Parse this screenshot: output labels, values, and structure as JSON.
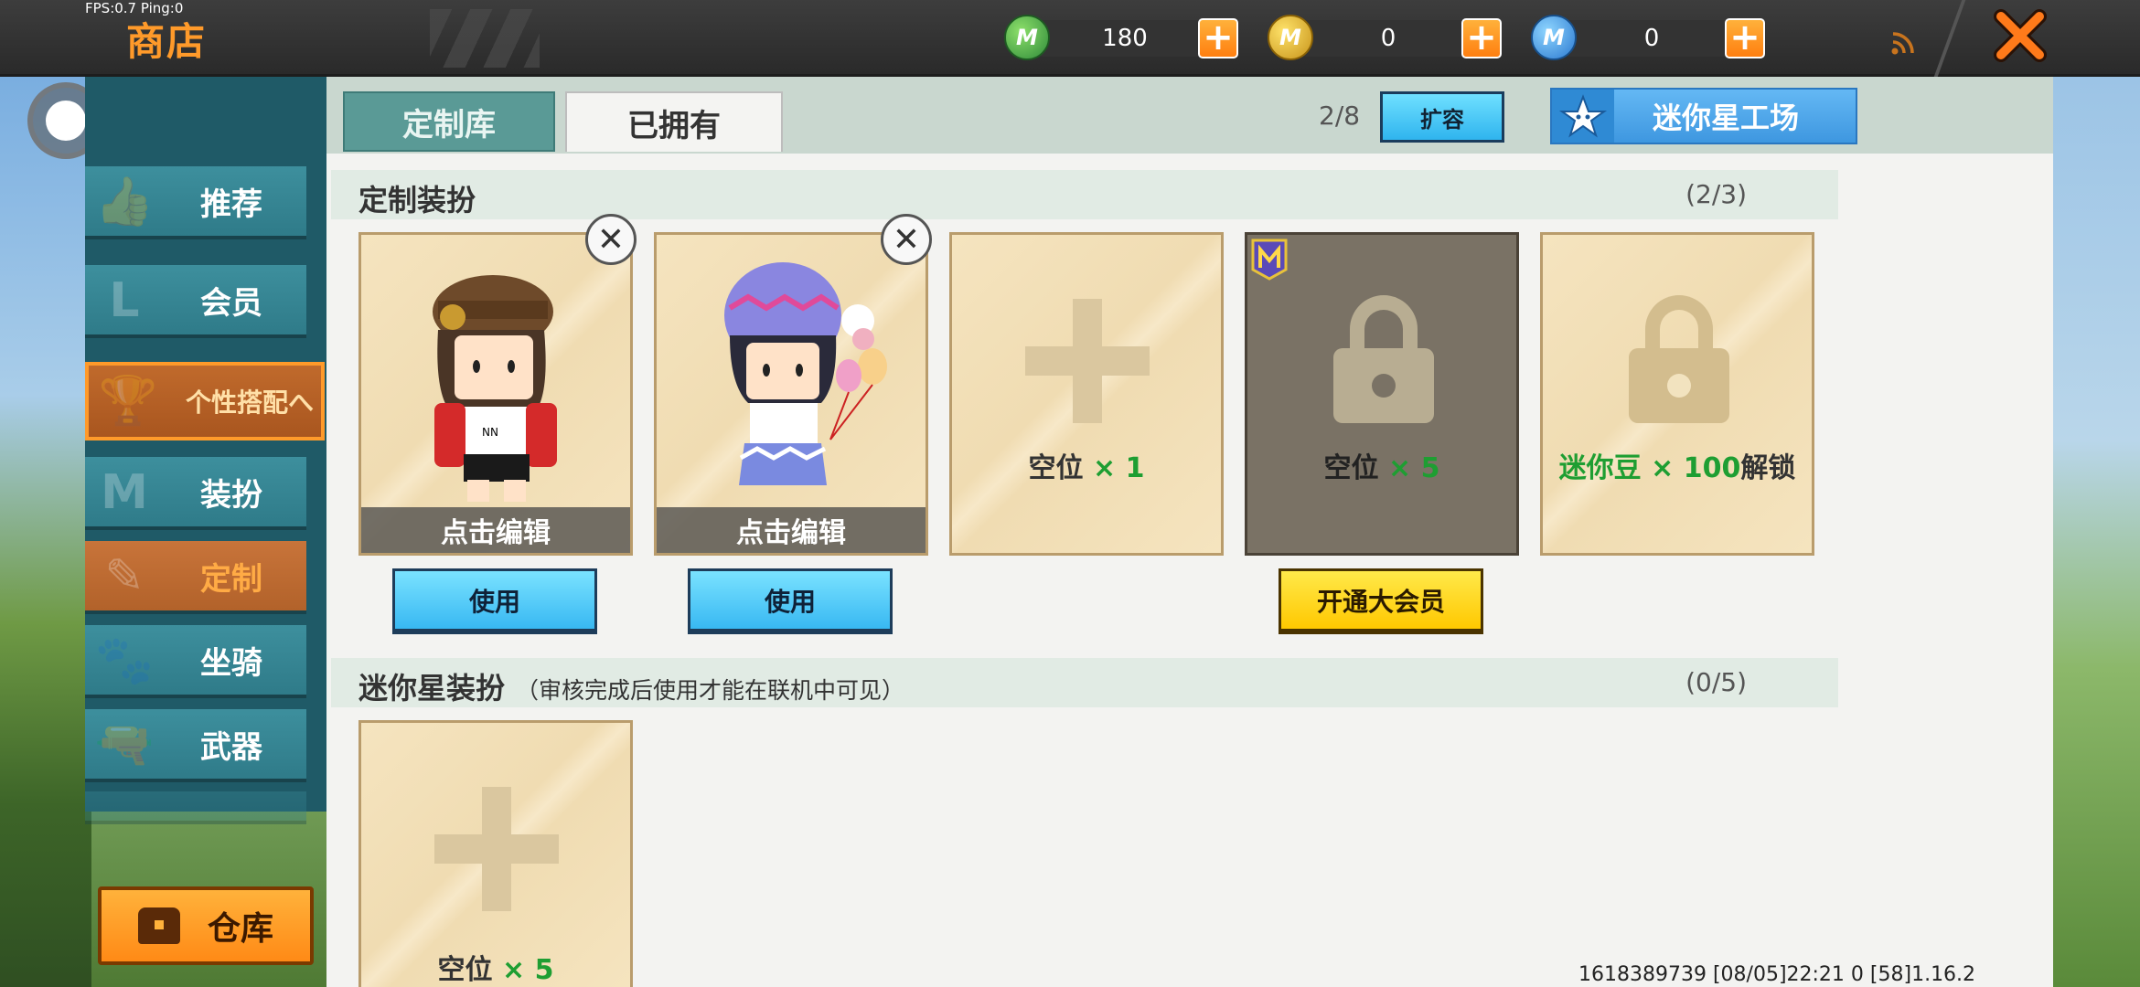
{
  "status": {
    "fps": "FPS:0.7  Ping:0"
  },
  "header": {
    "title": "商店"
  },
  "currencies": [
    {
      "name": "mini-bean",
      "value": "180",
      "color": "#3fa64a",
      "letter": "M"
    },
    {
      "name": "mini-coin",
      "value": "0",
      "color": "#e4b21c",
      "letter": "M"
    },
    {
      "name": "star-coin",
      "value": "0",
      "color": "#3d8ee0",
      "letter": "M"
    }
  ],
  "sidebar": {
    "items": [
      {
        "label": "推荐",
        "icon": "thumbs-up-icon"
      },
      {
        "label": "会员",
        "icon": "vip-icon"
      },
      {
        "label": "个性搭配へ",
        "icon": "trophy-icon"
      },
      {
        "label": "装扮",
        "icon": "shirt-icon"
      },
      {
        "label": "定制",
        "icon": "pencil-icon"
      },
      {
        "label": "坐骑",
        "icon": "mount-icon"
      },
      {
        "label": "武器",
        "icon": "gun-icon"
      }
    ],
    "warehouse_label": "仓库"
  },
  "tabs": {
    "custom": "定制库",
    "owned": "已拥有"
  },
  "capacity": "2/8",
  "expand_label": "扩容",
  "factory_label": "迷你星工场",
  "section1": {
    "title": "定制装扮",
    "count": "(2/3)",
    "slots": [
      {
        "type": "avatar",
        "edit_label": "点击编辑",
        "use_label": "使用"
      },
      {
        "type": "avatar",
        "edit_label": "点击编辑",
        "use_label": "使用"
      },
      {
        "type": "empty",
        "label_prefix": "空位",
        "label_count": "× 1"
      },
      {
        "type": "vip-locked",
        "label_prefix": "空位",
        "label_count": "× 5",
        "button_label": "开通大会员"
      },
      {
        "type": "locked",
        "label_green": "迷你豆 × 100",
        "label_suffix": "解锁"
      }
    ]
  },
  "section2": {
    "title": "迷你星装扮",
    "note": "（审核完成后使用才能在联机中可见）",
    "count": "(0/5)",
    "slot": {
      "label_prefix": "空位",
      "label_count": "× 5"
    }
  },
  "footer": {
    "info": "1618389739   [08/05]22:21 0  [58]1.16.2"
  }
}
